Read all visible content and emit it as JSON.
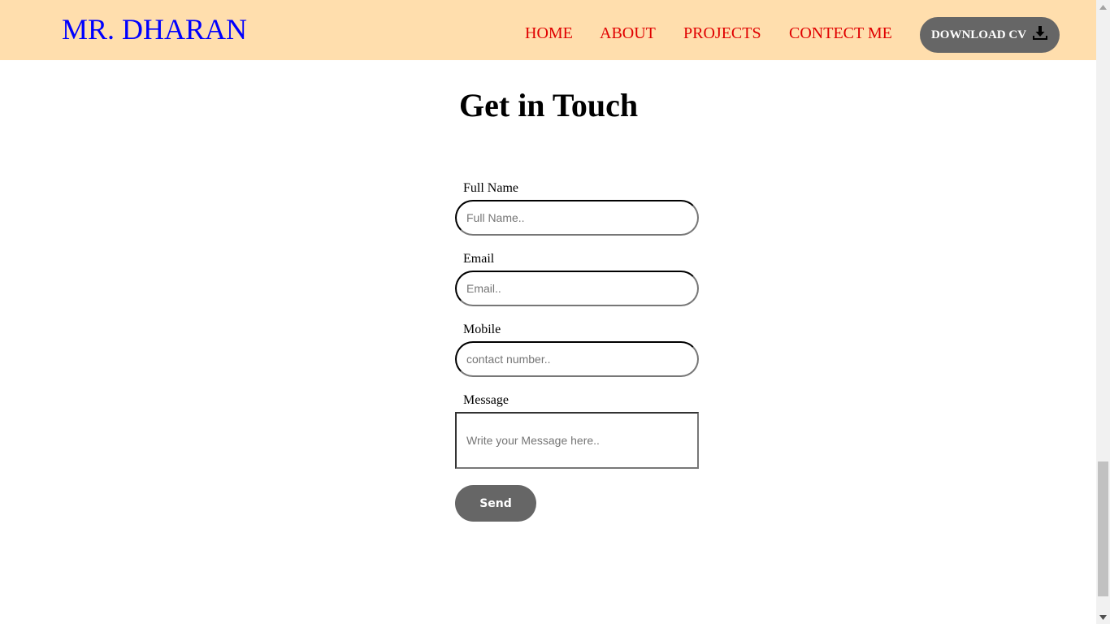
{
  "navbar": {
    "brand": "MR. DHARAN",
    "links": [
      "HOME",
      "ABOUT",
      "PROJECTS",
      "CONTECT ME"
    ],
    "download_label": "DOWNLOAD CV",
    "download_icon": "download-icon",
    "background": "#ffdead",
    "brand_color": "#0000ff",
    "link_color": "#e00000"
  },
  "contact": {
    "heading": "Get in Touch",
    "full_name": {
      "label": "Full Name",
      "placeholder": "Full Name..",
      "value": ""
    },
    "email": {
      "label": "Email",
      "placeholder": "Email..",
      "value": ""
    },
    "mobile": {
      "label": "Mobile",
      "placeholder": "contact number..",
      "value": ""
    },
    "message": {
      "label": "Message",
      "placeholder": "Write your Message here..",
      "value": ""
    },
    "send_label": "Send",
    "button_color": "#666666"
  }
}
